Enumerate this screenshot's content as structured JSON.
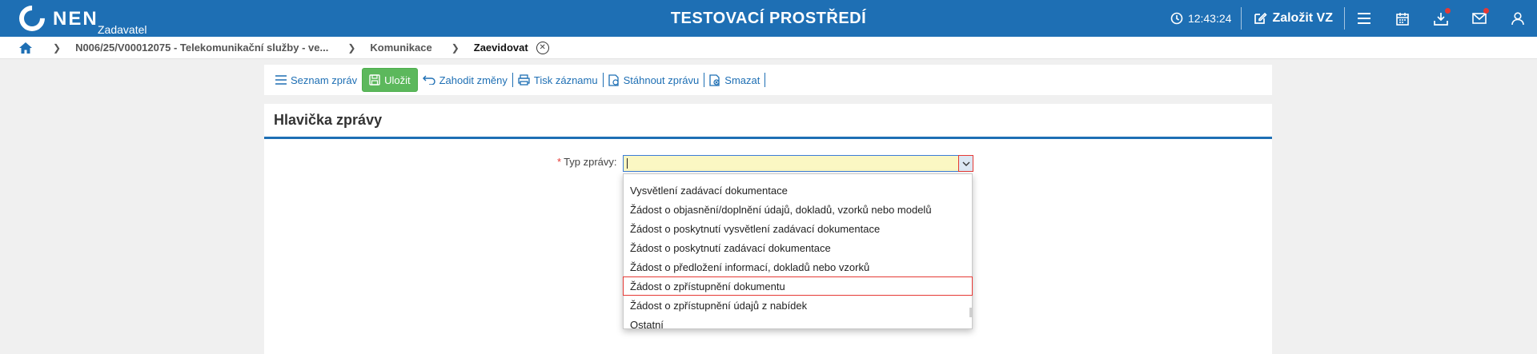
{
  "header": {
    "logo_text": "NEN",
    "logo_sub": "Zadavatel",
    "environment": "TESTOVACÍ PROSTŘEDÍ",
    "clock": "12:43:24",
    "create_vz_label": "Založit VZ",
    "icons": [
      "clock-icon",
      "edit-icon",
      "menu-icon",
      "calendar-icon",
      "download-icon",
      "mail-icon",
      "user-icon"
    ],
    "accent": "#1e6fb4"
  },
  "breadcrumb": {
    "items": [
      "N006/25/V00012075 - Telekomunikační služby - ve...",
      "Komunikace",
      "Zaevidovat"
    ]
  },
  "toolbar": {
    "items": [
      "Seznam zpráv",
      "Uložit",
      "Zahodit změny",
      "Tisk záznamu",
      "Stáhnout zprávu",
      "Smazat"
    ]
  },
  "panel": {
    "title": "Hlavička zprávy",
    "field_label": "Typ zprávy:",
    "required_mark": "*",
    "field_value": ""
  },
  "dropdown": {
    "options": [
      "Vysvětlení zadávací dokumentace",
      "Žádost o objasnění/doplnění údajů, dokladů, vzorků nebo modelů",
      "Žádost o poskytnutí vysvětlení zadávací dokumentace",
      "Žádost o poskytnutí zadávací dokumentace",
      "Žádost o předložení informací, dokladů nebo vzorků",
      "Žádost o zpřístupnění dokumentu",
      "Žádost o zpřístupnění údajů z nabídek",
      "Ostatní"
    ],
    "highlighted": "Žádost o zpřístupnění dokumentu"
  }
}
